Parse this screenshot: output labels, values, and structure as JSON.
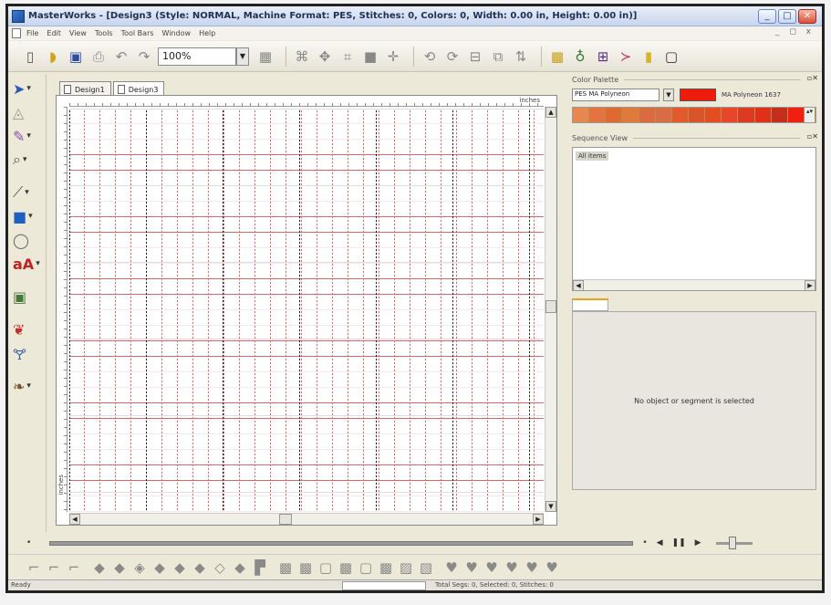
{
  "window": {
    "title": "MasterWorks - [Design3 (Style: NORMAL, Machine Format: PES, Stitches: 0, Colors: 0, Width: 0.00 in, Height: 0.00 in)]",
    "minimize": "_",
    "maximize": "□",
    "close": "✕"
  },
  "menu": {
    "items": [
      "File",
      "Edit",
      "View",
      "Tools",
      "Tool Bars",
      "Window",
      "Help"
    ],
    "mdi_controls": "_ ◻ x"
  },
  "toolbar": {
    "zoom_value": "100%",
    "icons": [
      "new-icon",
      "open-icon",
      "save-icon",
      "print-icon",
      "undo-icon",
      "redo-icon",
      "grid-icon",
      "select-all-icon",
      "move-icon",
      "mirror-icon",
      "fill-icon",
      "center-icon",
      "rotate-left-icon",
      "rotate-right-icon",
      "align-icon",
      "order-icon",
      "layer-icon",
      "texture-icon",
      "sound-icon",
      "grid-view-icon",
      "stitch-icon",
      "thread-icon",
      "monitor-icon"
    ]
  },
  "tabs": [
    {
      "label": "Design1",
      "active": false
    },
    {
      "label": "Design3",
      "active": true
    }
  ],
  "ruler": {
    "unit_top": "inches",
    "unit_left": "inches"
  },
  "color_palette": {
    "header": "Color Palette",
    "palette_name": "PES MA Polyneon",
    "selected_color_name": "MA Polyneon 1637",
    "selected_color": "#ee1c0a",
    "swatches": [
      "#e8864f",
      "#e4733f",
      "#e0692f",
      "#df7a3a",
      "#db6a3f",
      "#d76c45",
      "#e25a2a",
      "#d9542a",
      "#e34d22",
      "#e8452a",
      "#dd3a1f",
      "#e0301a",
      "#c32f1c",
      "#f01f10"
    ]
  },
  "sequence_view": {
    "header": "Sequence View",
    "items": [
      "All items"
    ]
  },
  "properties": {
    "empty_message": "No object or segment is selected"
  },
  "status": {
    "ready": "Ready",
    "info": "Total Segs: 0, Selected: 0, Stitches: 0"
  }
}
